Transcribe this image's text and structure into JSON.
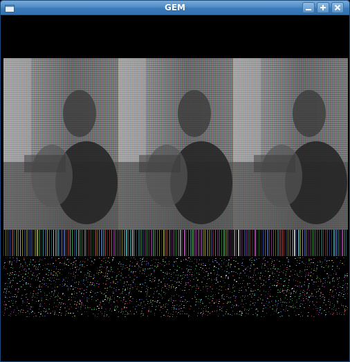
{
  "window": {
    "title": "GEM",
    "controls": {
      "minimize_icon": "minimize-icon",
      "maximize_icon": "maximize-icon",
      "close_icon": "close-icon"
    },
    "app_icon": "window-menu-icon"
  },
  "colors": {
    "titlebar": "#4f8cc7",
    "client_bg": "#000000",
    "video_gray": "#6a6a6a"
  }
}
